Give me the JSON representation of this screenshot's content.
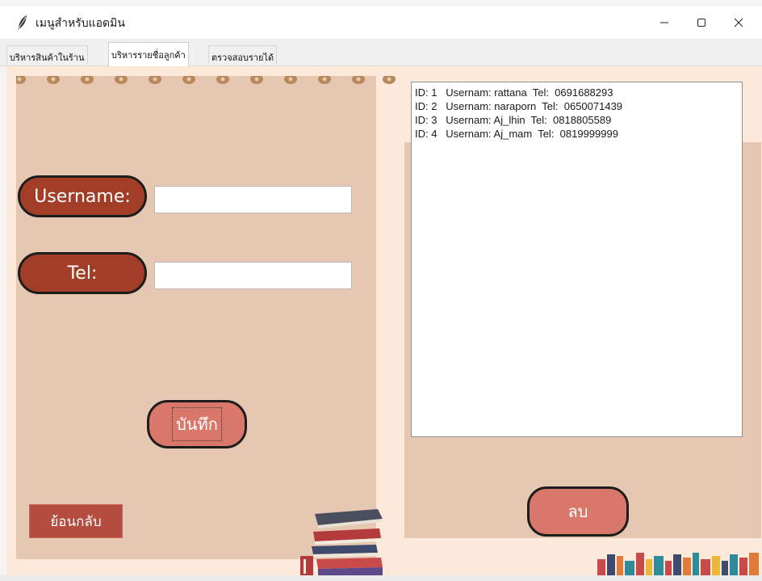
{
  "window": {
    "title": "เมนูสำหรับแอดมิน",
    "icon": "feather-icon"
  },
  "tabs": [
    {
      "label": "บริหารสินค้าในร้าน",
      "active": false
    },
    {
      "label": "บริหารรายชื่อลูกค้า",
      "active": true
    },
    {
      "label": "ตรวจสอบรายได้",
      "active": false
    }
  ],
  "form": {
    "username_label": "Username:",
    "username_value": "",
    "tel_label": "Tel:",
    "tel_value": "",
    "save_label": "บันทึก"
  },
  "customer_list": [
    "ID: 1   Usernam: rattana  Tel:  0691688293",
    "ID: 2   Usernam: naraporn  Tel:  0650071439",
    "ID: 3   Usernam: Aj_lhin  Tel:  0818805589",
    "ID: 4   Usernam: Aj_mam  Tel:  0819999999"
  ],
  "actions": {
    "delete_label": "ลบ",
    "back_label": "ย้อนกลับ"
  },
  "colors": {
    "panel": "#e6c7b1",
    "background": "#fde9da",
    "label_pill": "#a23d28",
    "button": "#d9786a",
    "back_button": "#b44d3f"
  }
}
